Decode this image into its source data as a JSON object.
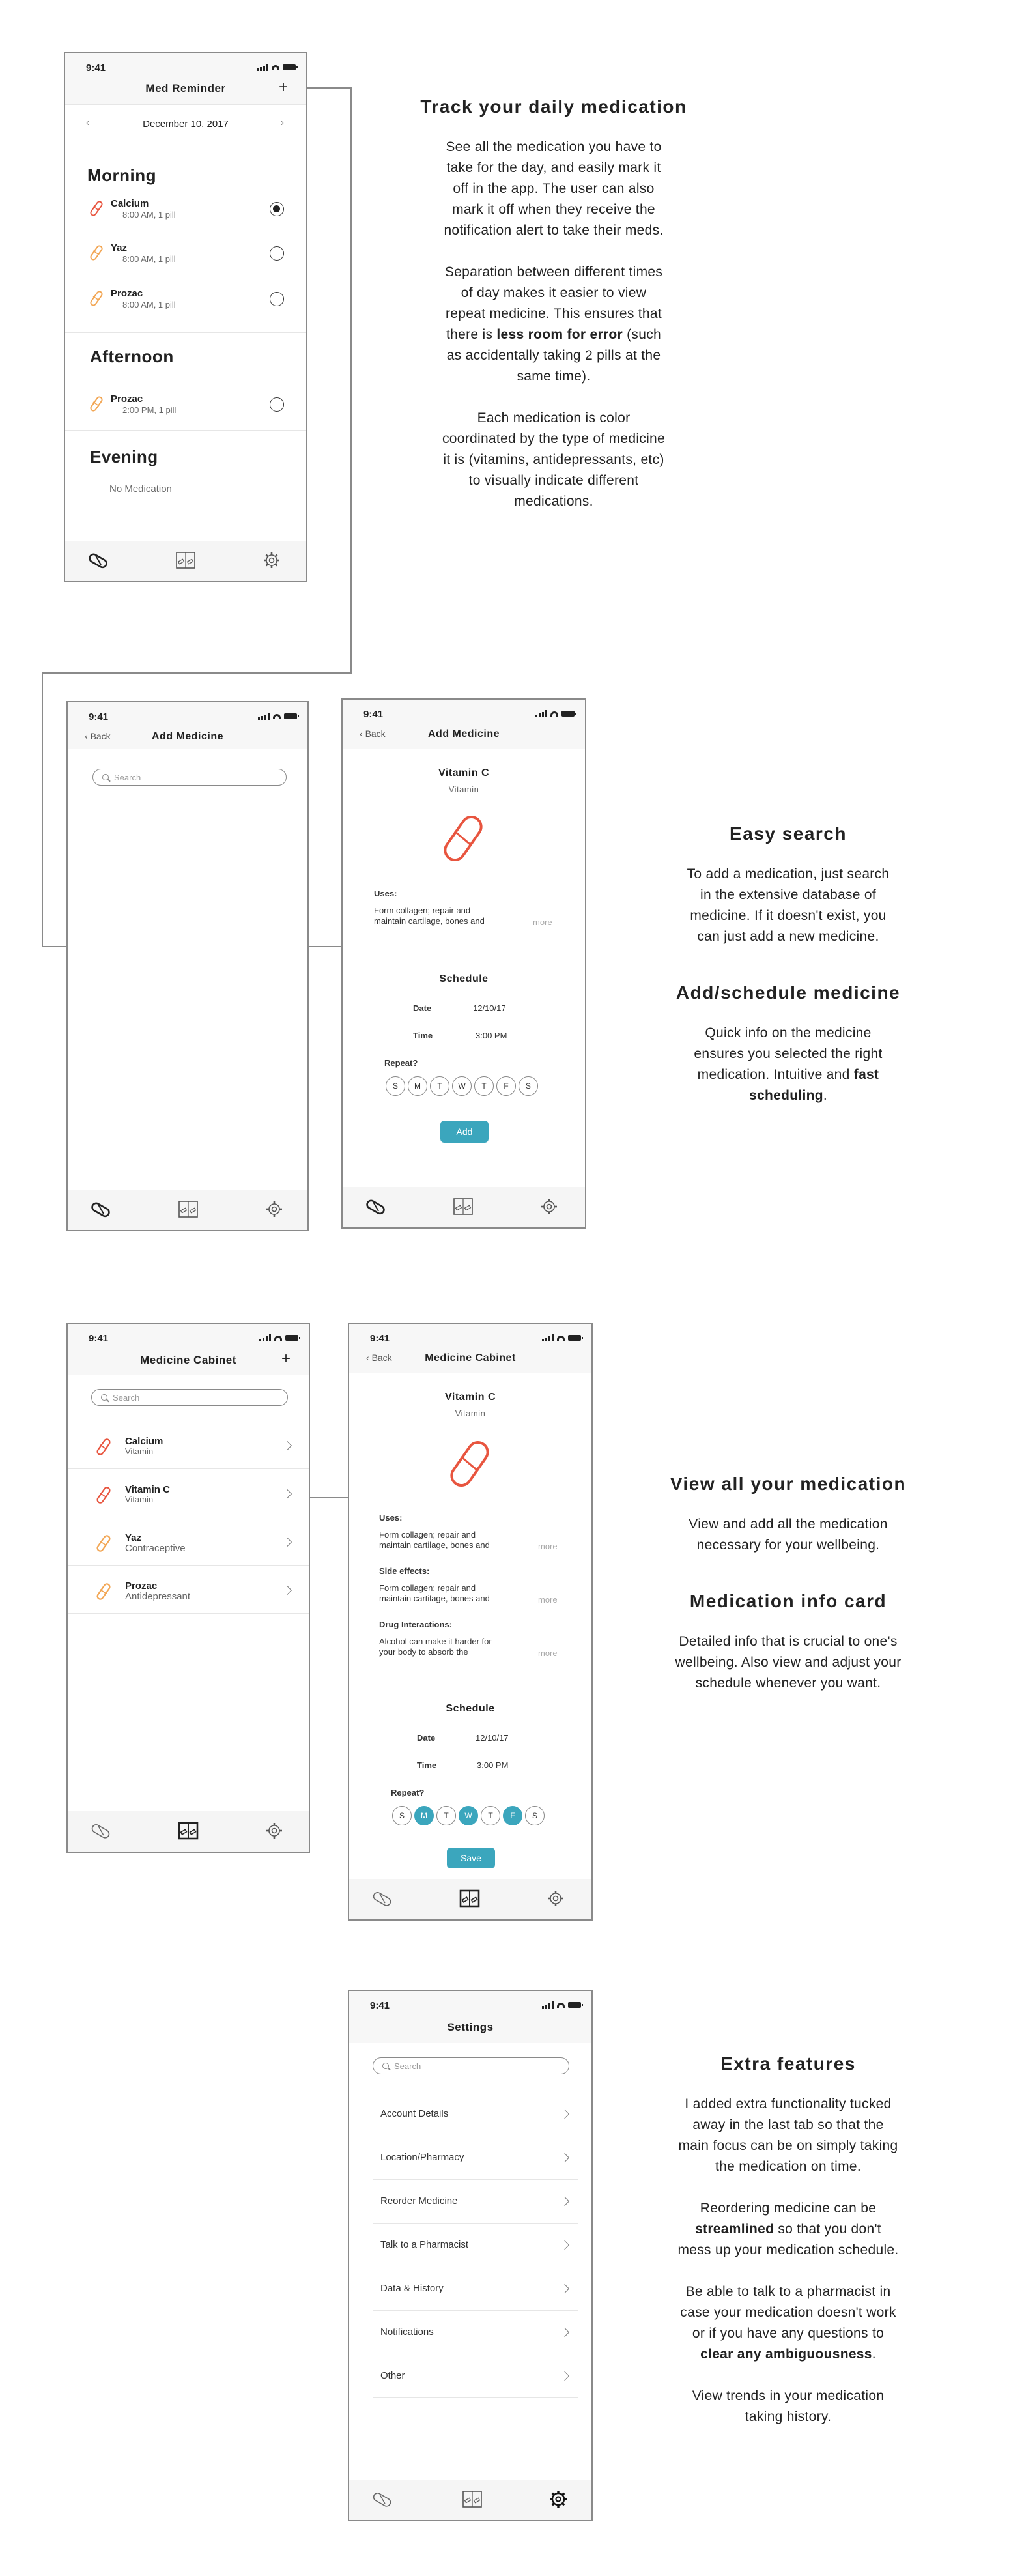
{
  "status_time": "9:41",
  "screen1": {
    "title": "Med Reminder",
    "plus": "+",
    "date": "December 10, 2017",
    "morning": "Morning",
    "afternoon": "Afternoon",
    "evening": "Evening",
    "meds": [
      {
        "name": "Calcium",
        "sub": "8:00 AM, 1 pill",
        "color": "#e8553f",
        "checked": true
      },
      {
        "name": "Yaz",
        "sub": "8:00 AM, 1 pill",
        "color": "#f2a654",
        "checked": false
      },
      {
        "name": "Prozac",
        "sub": "8:00 AM, 1 pill",
        "color": "#f2a654",
        "checked": false
      },
      {
        "name": "Prozac",
        "sub": "2:00 PM, 1 pill",
        "color": "#f2a654",
        "checked": false
      }
    ],
    "no_medication": "No Medication"
  },
  "screen2": {
    "back": "Back",
    "title": "Add Medicine",
    "search": "Search"
  },
  "screen3": {
    "back": "Back",
    "title": "Add Medicine",
    "med_name": "Vitamin C",
    "med_type": "Vitamin",
    "uses_label": "Uses:",
    "uses_text_1": "Form collagen; repair and",
    "uses_text_2": "maintain cartilage, bones and",
    "more": "more",
    "schedule": "Schedule",
    "date_label": "Date",
    "date_value": "12/10/17",
    "time_label": "Time",
    "time_value": "3:00 PM",
    "repeat_label": "Repeat?",
    "days": [
      "S",
      "M",
      "T",
      "W",
      "T",
      "F",
      "S"
    ],
    "add_button": "Add"
  },
  "screen4": {
    "title": "Medicine Cabinet",
    "plus": "+",
    "search": "Search",
    "items": [
      {
        "name": "Calcium",
        "sub": "Vitamin",
        "color": "#e8553f"
      },
      {
        "name": "Vitamin C",
        "sub": "Vitamin",
        "color": "#e8553f"
      },
      {
        "name": "Yaz",
        "sub": "Contraceptive",
        "color": "#f2a654"
      },
      {
        "name": "Prozac",
        "sub": "Antidepressant",
        "color": "#f2a654"
      }
    ]
  },
  "screen5": {
    "back": "Back",
    "title": "Medicine Cabinet",
    "med_name": "Vitamin C",
    "med_type": "Vitamin",
    "uses_label": "Uses:",
    "uses_text_1": "Form collagen; repair and",
    "uses_text_2": "maintain cartilage, bones and",
    "side_label": "Side effects:",
    "side_text_1": "Form collagen; repair and",
    "side_text_2": "maintain cartilage, bones and",
    "drug_label": "Drug Interactions:",
    "drug_text_1": "Alcohol can make it harder for",
    "drug_text_2": "your body to absorb the",
    "more": "more",
    "schedule": "Schedule",
    "date_label": "Date",
    "date_value": "12/10/17",
    "time_label": "Time",
    "time_value": "3:00 PM",
    "repeat_label": "Repeat?",
    "days": [
      "S",
      "M",
      "T",
      "W",
      "T",
      "F",
      "S"
    ],
    "selected_days": [
      1,
      3,
      5
    ],
    "save_button": "Save"
  },
  "screen6": {
    "title": "Settings",
    "search": "Search",
    "items": [
      "Account Details",
      "Location/Pharmacy",
      "Reorder Medicine",
      "Talk to a Pharmacist",
      "Data & History",
      "Notifications",
      "Other"
    ]
  },
  "descriptions": {
    "d1_title": "Track your daily medication",
    "d1_p1": "See all the medication you have to take for the day, and easily mark it off in the app. The user can also mark it off when they receive the notification alert to take their meds.",
    "d1_p2a": "Separation between different times of day makes it easier to view repeat medicine. This ensures that there is ",
    "d1_p2b": "less room for error",
    "d1_p2c": " (such as accidentally taking 2 pills at the same time).",
    "d1_p3": "Each medication is color coordinated by the type of medicine it is (vitamins, antidepressants, etc) to visually indicate different medications.",
    "d2_title": "Easy search",
    "d2_p1": "To add a medication, just search in the extensive database of medicine. If it doesn't exist, you can just add a new medicine.",
    "d3_title": "Add/schedule medicine",
    "d3_p1a": "Quick info on the medicine ensures you selected the right medication. Intuitive and ",
    "d3_p1b": "fast scheduling",
    "d3_p1c": ".",
    "d4_title": "View all your medication",
    "d4_p1": "View and add all the medication necessary for your wellbeing.",
    "d5_title": "Medication info card",
    "d5_p1": "Detailed info that is crucial to one's wellbeing. Also view and adjust your schedule whenever you want.",
    "d6_title": "Extra features",
    "d6_p1": "I added extra functionality tucked away in the last tab so that the main focus can be on simply taking the medication on time.",
    "d6_p2a": "Reordering medicine can be ",
    "d6_p2b": "streamlined",
    "d6_p2c": " so that you don't mess up your medication schedule.",
    "d6_p3a": "Be able to talk to a pharmacist in case your medication doesn't work or if you have any questions to ",
    "d6_p3b": "clear any ambiguousness",
    "d6_p3c": ".",
    "d6_p4": "View trends in your medication taking history."
  },
  "icons": {
    "tab1": "pill-icon",
    "tab2": "cabinet-icon",
    "tab3": "gear-icon"
  },
  "colors": {
    "accent": "#3ba6bd",
    "vitamin": "#e8553f",
    "other": "#f2a654"
  }
}
